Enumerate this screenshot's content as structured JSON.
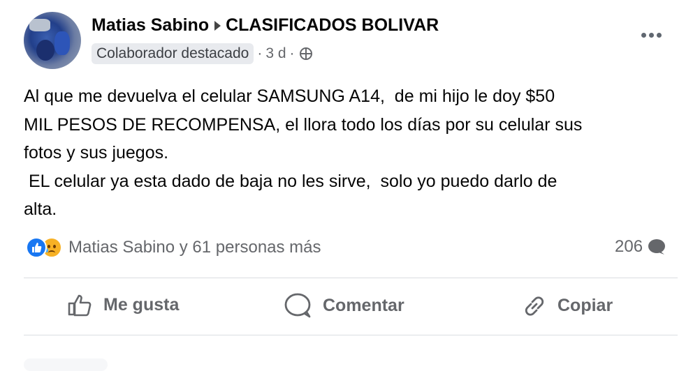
{
  "post": {
    "author": "Matias Sabino",
    "group": "CLASIFICADOS BOLIVAR",
    "badge": "Colaborador destacado",
    "time": "3 d",
    "text": "Al que me devuelva el celular SAMSUNG A14,  de mi hijo le doy $50\nMIL PESOS DE RECOMPENSA, el llora todo los días por su celular sus\nfotos y sus juegos.\n EL celular ya esta dado de baja no les sirve,  solo yo puedo darlo de\nalta."
  },
  "reactions": {
    "summary": "Matias Sabino y 61 personas más",
    "comments": "206",
    "icons": [
      "like-icon",
      "sad-icon",
      "comment-icon"
    ]
  },
  "actions": {
    "like_label": "Me gusta",
    "comment_label": "Comentar",
    "copy_label": "Copiar"
  },
  "colors": {
    "text": "#050505",
    "secondary": "#65676b",
    "like_blue": "#1877f2",
    "sad_yellow": "#f7b125",
    "divider": "#dadde1"
  }
}
